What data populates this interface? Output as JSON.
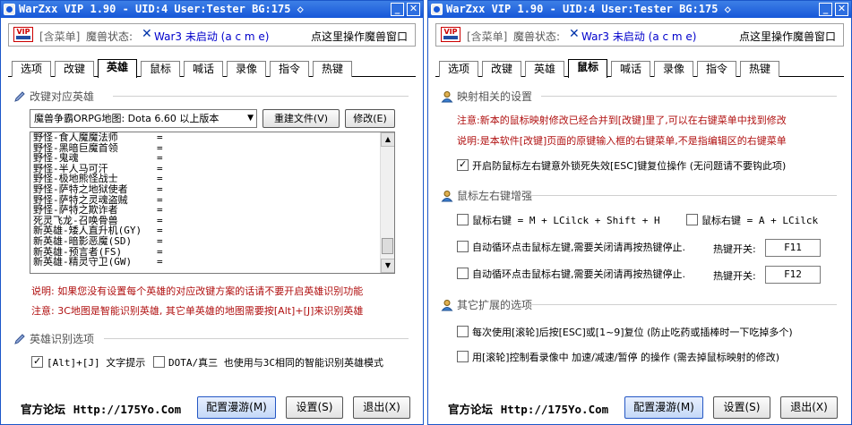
{
  "colors": {
    "title_bar": "#1657d8",
    "note_red": "#b01010",
    "war3_blue": "#0000cc"
  },
  "icons": {
    "app": "app-icon",
    "vip": "vip-badge",
    "minimize": "minimize-icon",
    "close": "close-icon",
    "section": "pen-icon",
    "section_right": "user-icon"
  },
  "common": {
    "title": "WarZxx VIP 1.90 - UID:4 User:Tester  BG:175 ◇",
    "minimize": "_",
    "close": "✕",
    "vip_text": "VIP",
    "status_menu": "[含菜单]",
    "status_label": "魔兽状态:",
    "status_x": "✕",
    "status_war3": "War3 未启动 (a c m e)",
    "status_action": "点这里操作魔兽窗口",
    "tabs": [
      "选项",
      "改键",
      "英雄",
      "鼠标",
      "喊话",
      "录像",
      "指令",
      "热键"
    ],
    "forum_label": "官方论坛",
    "forum_url": "Http://175Yo.Com",
    "btn_roam": "配置漫游(M)",
    "btn_settings": "设置(S)",
    "btn_exit": "退出(X)"
  },
  "left": {
    "active_tab": "英雄",
    "section1": "改键对应英雄",
    "map_select": "魔兽争霸ORPG地图: Dota 6.60 以上版本",
    "btn_rebuild": "重建文件(V)",
    "btn_modify": "修改(E)",
    "heroes": [
      "野怪-食人魔魔法师",
      "野怪-黑暗巨魔首领",
      "野怪-鬼魂",
      "野怪-半人马可汗",
      "野怪-极地熊怪战士",
      "野怪-萨特之地狱使者",
      "野怪-萨特之灵魂盗贼",
      "野怪-萨特之欺诈者",
      "死灵飞龙-召唤骨兽",
      "新英雄-矮人直升机(GY)",
      "新英雄-暗影恶魔(SD)",
      "新英雄-预言者(FS)",
      "新英雄-精灵守卫(GW)"
    ],
    "eq": "=",
    "note1": "说明: 如果您没有设置每个英雄的对应改键方案的话请不要开启英雄识别功能",
    "note2": "注意: 3C地图是智能识别英雄, 其它单英雄的地图需要按[Alt]+[J]来识别英雄",
    "section2": "英雄识别选项",
    "chk_altj": "[Alt]+[J] 文字提示",
    "chk_dota": "DOTA/真三 也使用与3C相同的智能识别英雄模式"
  },
  "right": {
    "active_tab": "鼠标",
    "section1": "映射相关的设置",
    "note1": "注意:新本的鼠标映射修改已经合并到[改键]里了,可以在右键菜单中找到修改",
    "note2": "说明:是本软件[改键]页面的原键输入框的右键菜单,不是指编辑区的右键菜单",
    "chk_esc": "开启防鼠标左右键意外锁死失效[ESC]键复位操作 (无问题请不要钩此项)",
    "section2": "鼠标左右键增强",
    "chk_rclick_m": "鼠标右键 = M + LCilck + Shift + H",
    "chk_rclick_a": "鼠标右键 = A + LCilck",
    "chk_auto_left": "自动循环点击鼠标左键,需要关闭请再按热键停止.",
    "hotkey_label1": "热键开关:",
    "hotkey1": "F11",
    "chk_auto_right": "自动循环点击鼠标右键,需要关闭请再按热键停止.",
    "hotkey_label2": "热键开关:",
    "hotkey2": "F12",
    "section3": "其它扩展的选项",
    "chk_wheel": "每次使用[滚轮]后按[ESC]或[1~9]复位 (防止吃药或插棒时一下吃掉多个)",
    "chk_replay": "用[滚轮]控制看录像中 加速/减速/暂停 的操作 (需去掉鼠标映射的修改)"
  }
}
